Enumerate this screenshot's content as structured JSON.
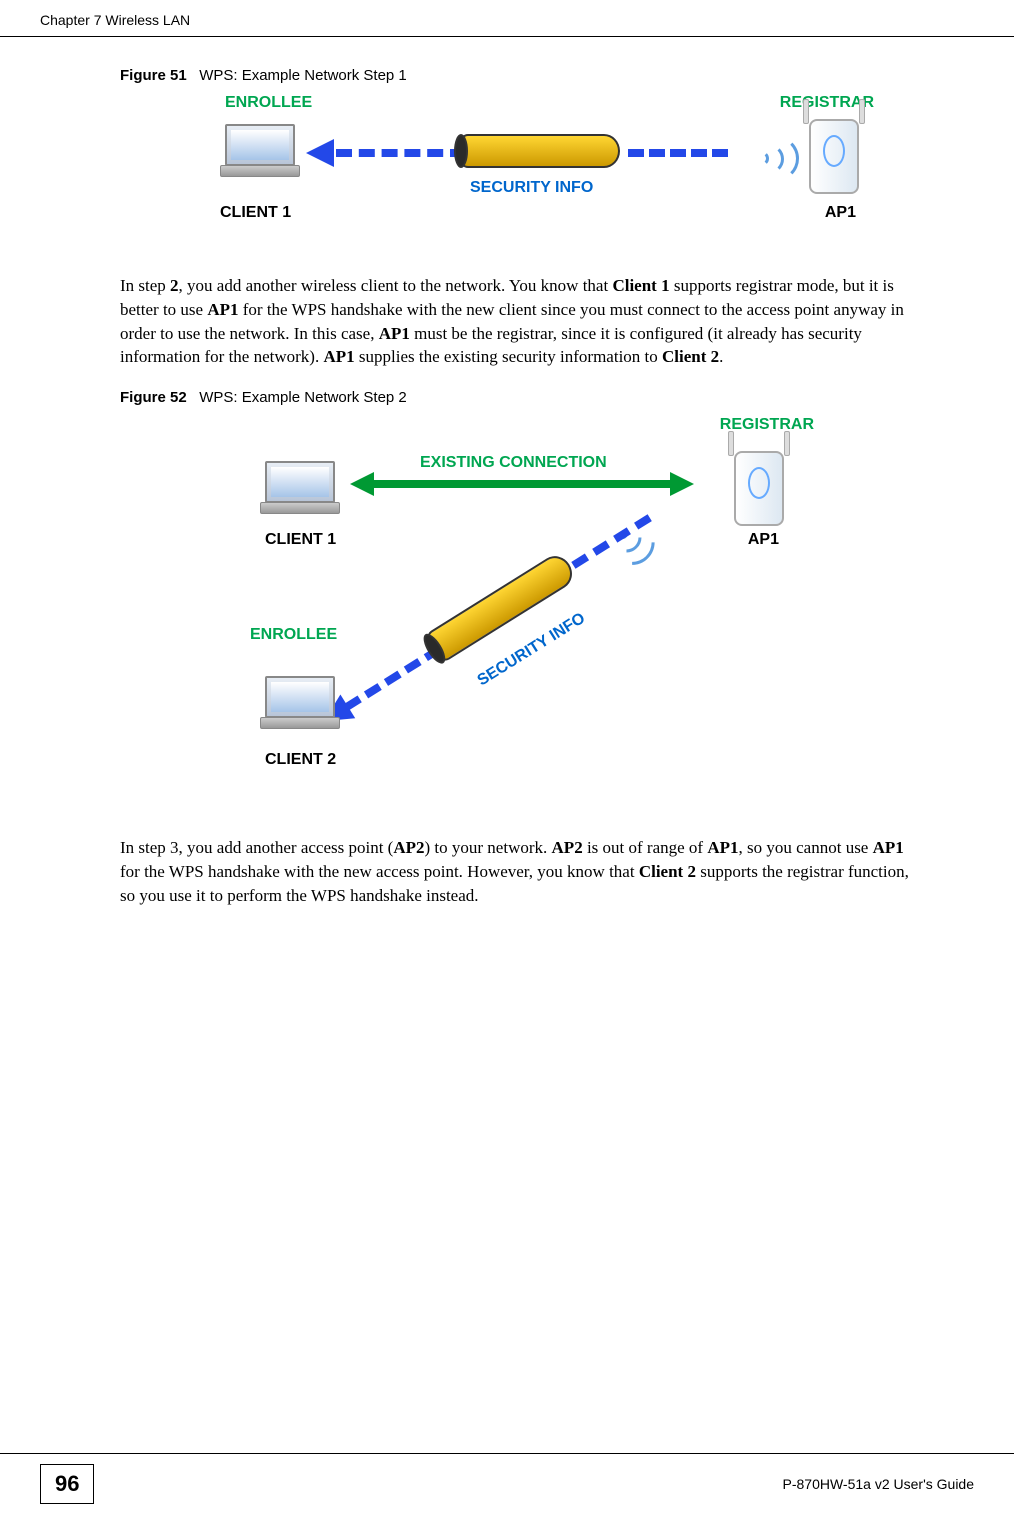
{
  "header": {
    "chapter": "Chapter 7 Wireless LAN"
  },
  "figures": {
    "fig51": {
      "prefix": "Figure 51",
      "title": "WPS: Example Network Step 1",
      "labels": {
        "enrollee": "ENROLLEE",
        "registrar": "REGISTRAR",
        "security_info": "SECURITY INFO",
        "client1": "CLIENT 1",
        "ap1": "AP1"
      }
    },
    "fig52": {
      "prefix": "Figure 52",
      "title": "WPS: Example Network Step 2",
      "labels": {
        "registrar": "REGISTRAR",
        "existing_connection": "EXISTING CONNECTION",
        "client1": "CLIENT 1",
        "ap1": "AP1",
        "enrollee": "ENROLLEE",
        "security_info": "SECURITY INFO",
        "client2": "CLIENT 2"
      }
    }
  },
  "paragraphs": {
    "p1_part1": "In step ",
    "p1_bold1": "2",
    "p1_part2": ", you add another wireless client to the network. You know that ",
    "p1_bold2": "Client 1",
    "p1_part3": " supports registrar mode, but it is better to use ",
    "p1_bold3": "AP1",
    "p1_part4": " for the WPS handshake with the new client since you must connect to the access point anyway in order to use the network. In this case, ",
    "p1_bold4": "AP1",
    "p1_part5": " must be the registrar, since it is configured (it already has security information for the network). ",
    "p1_bold5": "AP1",
    "p1_part6": " supplies the existing security information to ",
    "p1_bold6": "Client 2",
    "p1_part7": ".",
    "p2_part1": "In step 3, you add another access point (",
    "p2_bold1": "AP2",
    "p2_part2": ") to your network. ",
    "p2_bold2": "AP2",
    "p2_part3": " is out of range of ",
    "p2_bold3": "AP1",
    "p2_part4": ", so you cannot use ",
    "p2_bold4": "AP1",
    "p2_part5": " for the WPS handshake with the new access point. However, you know that ",
    "p2_bold5": "Client 2",
    "p2_part6": " supports the registrar function, so you use it to perform the WPS handshake instead."
  },
  "footer": {
    "page_number": "96",
    "guide": "P-870HW-51a v2 User's Guide"
  }
}
